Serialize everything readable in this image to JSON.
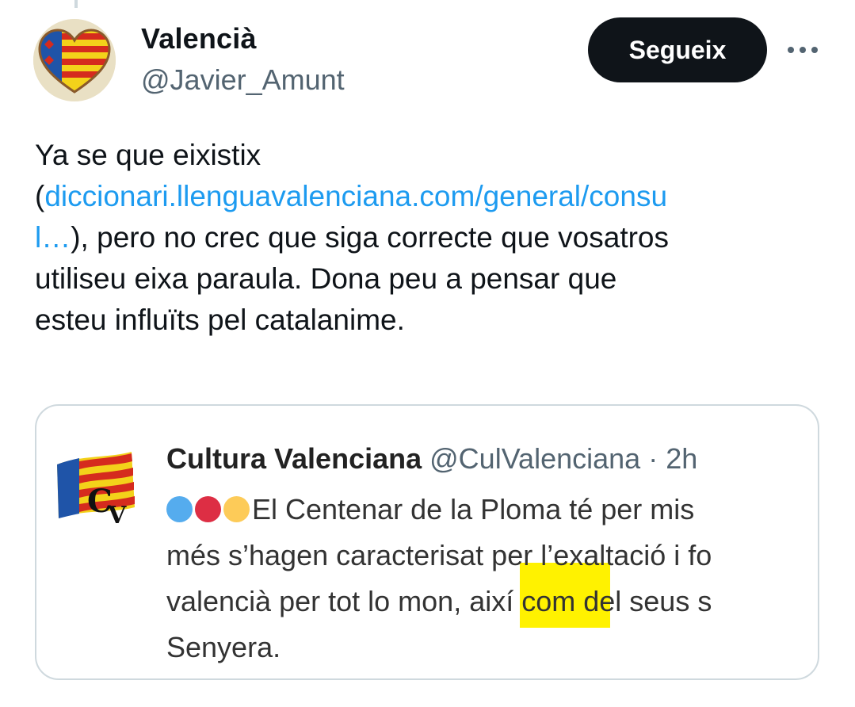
{
  "tweet": {
    "author_name": "Valencià",
    "author_handle": "@Javier_Amunt",
    "follow_label": "Segueix",
    "text_lines": [
      {
        "plain": "Ya se que eixistix",
        "link": ""
      },
      {
        "prefix": "(",
        "link": "diccionari.llenguavalenciana.com/general/consu"
      },
      {
        "link": "l…",
        "plain": "), pero no crec que siga correcte que vosatros"
      },
      {
        "plain": "utiliseu eixa paraula. Dona peu a pensar que"
      },
      {
        "plain": "esteu influïts pel catalanime."
      }
    ]
  },
  "quote": {
    "author_name": "Cultura Valenciana",
    "author_handle": "@CulValenciana",
    "separator": "·",
    "time": "2h",
    "lines": [
      "El Centenar de la Ploma té per mis",
      "més s’hagen caracterisat per l’exaltació i fo",
      "valencià per tot lo mon, així com del seus s",
      "Senyera."
    ],
    "dot_colors": [
      "#55acee",
      "#dd2e44",
      "#fdcb58"
    ]
  },
  "colors": {
    "link": "#1d9bf0",
    "highlight": "#fff200",
    "button": "#0f1419"
  }
}
